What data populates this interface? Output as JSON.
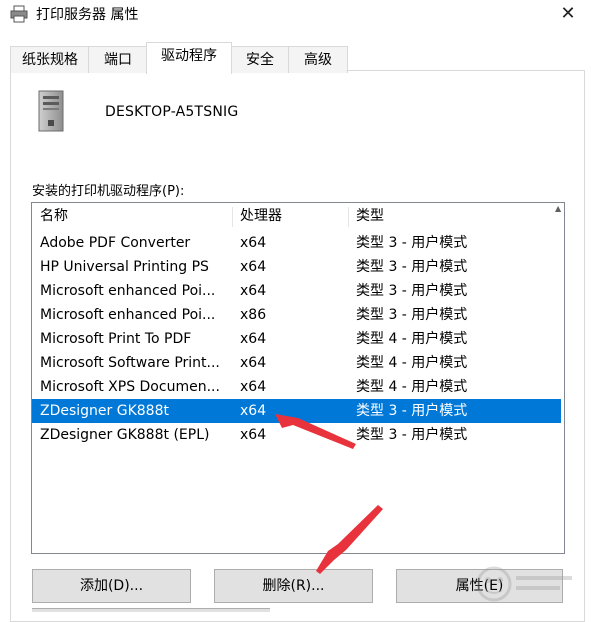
{
  "window": {
    "title": "打印服务器 属性",
    "close_glyph": "✕"
  },
  "tabs": [
    {
      "label": "纸张规格"
    },
    {
      "label": "端口"
    },
    {
      "label": "驱动程序"
    },
    {
      "label": "安全"
    },
    {
      "label": "高级"
    }
  ],
  "active_tab": "驱动程序",
  "server": {
    "name": "DESKTOP-A5TSNIG",
    "icon": "computer-tower-icon"
  },
  "drivers": {
    "label": "安装的打印机驱动程序(P):",
    "columns": [
      "名称",
      "处理器",
      "类型"
    ],
    "rows": [
      {
        "name": "Adobe PDF Converter",
        "processor": "x64",
        "type": "类型 3 - 用户模式"
      },
      {
        "name": "HP Universal Printing PS",
        "processor": "x64",
        "type": "类型 3 - 用户模式"
      },
      {
        "name": "Microsoft enhanced Poi...",
        "processor": "x64",
        "type": "类型 3 - 用户模式"
      },
      {
        "name": "Microsoft enhanced Poi...",
        "processor": "x86",
        "type": "类型 3 - 用户模式"
      },
      {
        "name": "Microsoft Print To PDF",
        "processor": "x64",
        "type": "类型 4 - 用户模式"
      },
      {
        "name": "Microsoft Software Print...",
        "processor": "x64",
        "type": "类型 4 - 用户模式"
      },
      {
        "name": "Microsoft XPS Documen...",
        "processor": "x64",
        "type": "类型 4 - 用户模式"
      },
      {
        "name": "ZDesigner GK888t",
        "processor": "x64",
        "type": "类型 3 - 用户模式"
      },
      {
        "name": "ZDesigner GK888t (EPL)",
        "processor": "x64",
        "type": "类型 3 - 用户模式"
      }
    ],
    "selected_row": 7
  },
  "buttons": {
    "add": "添加(D)...",
    "remove": "删除(R)...",
    "properties": "属性(E)"
  },
  "colors": {
    "selection": "#0078d7",
    "annotation": "#e8323c"
  }
}
